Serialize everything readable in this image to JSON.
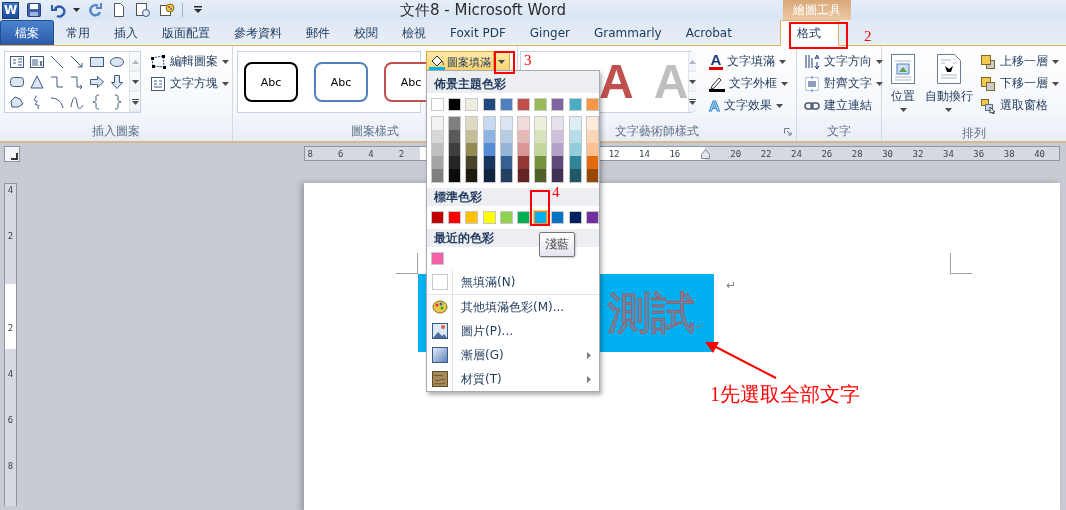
{
  "window": {
    "app_letter": "W",
    "title": "文件8 - Microsoft Word",
    "context_label": "繪圖工具"
  },
  "tabs": [
    {
      "label": "檔案",
      "kind": "file",
      "selected": false
    },
    {
      "label": "常用",
      "kind": "tab",
      "selected": false
    },
    {
      "label": "插入",
      "kind": "tab",
      "selected": false
    },
    {
      "label": "版面配置",
      "kind": "tab",
      "selected": false
    },
    {
      "label": "參考資料",
      "kind": "tab",
      "selected": false
    },
    {
      "label": "郵件",
      "kind": "tab",
      "selected": false
    },
    {
      "label": "校閱",
      "kind": "tab",
      "selected": false
    },
    {
      "label": "檢視",
      "kind": "tab",
      "selected": false
    },
    {
      "label": "Foxit PDF",
      "kind": "tab",
      "selected": false
    },
    {
      "label": "Ginger",
      "kind": "tab",
      "selected": false
    },
    {
      "label": "Grammarly",
      "kind": "tab",
      "selected": false
    },
    {
      "label": "Acrobat",
      "kind": "tab",
      "selected": false
    },
    {
      "label": "格式",
      "kind": "context",
      "selected": true
    }
  ],
  "ribbon": {
    "insert_shapes": {
      "label": "插入圖案",
      "buttons": [
        {
          "label": "編輯圖案",
          "kind": "edit_shape",
          "menu": true
        },
        {
          "label": "文字方塊",
          "kind": "text_box",
          "menu": true
        }
      ]
    },
    "shape_styles": {
      "label": "圖案樣式",
      "samples": [
        {
          "text": "Abc",
          "color": "#000000"
        },
        {
          "text": "Abc",
          "color": "#4f81bd"
        },
        {
          "text": "Abc",
          "color": "#c0504d"
        }
      ],
      "fill_button": {
        "label": "圖案填滿",
        "expanded": true
      }
    },
    "wordart_styles": {
      "label": "文字藝術師樣式",
      "samples": [
        {
          "text": "A",
          "color": "#c0504d"
        },
        {
          "text": "A",
          "color": "#bfbfbf"
        }
      ],
      "buttons": [
        {
          "label": "文字填滿",
          "kind": "text_fill",
          "icon_text": "A",
          "menu": true
        },
        {
          "label": "文字外框",
          "kind": "text_outline",
          "menu": true
        },
        {
          "label": "文字效果",
          "kind": "text_effects",
          "icon_text": "A",
          "menu": true
        }
      ]
    },
    "text": {
      "label": "文字",
      "buttons": [
        {
          "label": "文字方向",
          "kind": "direction",
          "menu": true
        },
        {
          "label": "對齊文字",
          "kind": "align",
          "menu": true
        },
        {
          "label": "建立連結",
          "kind": "link",
          "menu": false
        }
      ]
    },
    "arrange": {
      "label": "排列",
      "large_buttons": [
        {
          "label": "位置",
          "kind": "position"
        },
        {
          "label": "自動換行",
          "kind": "wrap"
        }
      ],
      "buttons": [
        {
          "label": "上移一層",
          "kind": "forward",
          "menu": true
        },
        {
          "label": "下移一層",
          "kind": "backward",
          "menu": true
        },
        {
          "label": "選取窗格",
          "kind": "pane",
          "menu": false
        }
      ]
    }
  },
  "ruler": {
    "left_labels": [
      "8",
      "6",
      "4",
      "2"
    ],
    "labels_before_marker": [
      "12",
      "14",
      "16"
    ],
    "labels_after_marker": [
      "20",
      "22",
      "24",
      "26",
      "28",
      "30",
      "32",
      "34",
      "36",
      "38",
      "40"
    ]
  },
  "vertical_ruler": {
    "above": [
      "4",
      "2"
    ],
    "below": [
      "2",
      "4",
      "6",
      "8"
    ]
  },
  "document": {
    "selected_text": "測試",
    "text_end_mark": "↵",
    "paragraph_mark": "↵"
  },
  "fill_menu": {
    "theme_header": "佈景主題色彩",
    "theme_columns": [
      {
        "color": "#ffffff",
        "shades": [
          {
            "color": "#f2f2f2"
          },
          {
            "color": "#d8d8d8"
          },
          {
            "color": "#bfbfbf"
          },
          {
            "color": "#a5a5a5"
          },
          {
            "color": "#7f7f7f"
          }
        ]
      },
      {
        "color": "#000000",
        "shades": [
          {
            "color": "#7f7f7f"
          },
          {
            "color": "#595959"
          },
          {
            "color": "#3f3f3f"
          },
          {
            "color": "#262626"
          },
          {
            "color": "#0c0c0c"
          }
        ]
      },
      {
        "color": "#eeece1",
        "shades": [
          {
            "color": "#ddd9c3"
          },
          {
            "color": "#c4bd97"
          },
          {
            "color": "#938953"
          },
          {
            "color": "#494429"
          },
          {
            "color": "#1d1b10"
          }
        ]
      },
      {
        "color": "#1f497d",
        "shades": [
          {
            "color": "#c6d9f0"
          },
          {
            "color": "#8db3e2"
          },
          {
            "color": "#548dd4"
          },
          {
            "color": "#17365d"
          },
          {
            "color": "#0f243e"
          }
        ]
      },
      {
        "color": "#4f81bd",
        "shades": [
          {
            "color": "#dbe5f1"
          },
          {
            "color": "#b8cce4"
          },
          {
            "color": "#95b3d7"
          },
          {
            "color": "#366092"
          },
          {
            "color": "#244061"
          }
        ]
      },
      {
        "color": "#c0504d",
        "shades": [
          {
            "color": "#f2dcdb"
          },
          {
            "color": "#e5b9b7"
          },
          {
            "color": "#d99694"
          },
          {
            "color": "#953734"
          },
          {
            "color": "#632423"
          }
        ]
      },
      {
        "color": "#9bbb59",
        "shades": [
          {
            "color": "#ebf1dd"
          },
          {
            "color": "#d7e3bc"
          },
          {
            "color": "#c3d69b"
          },
          {
            "color": "#76923c"
          },
          {
            "color": "#4f6128"
          }
        ]
      },
      {
        "color": "#8064a2",
        "shades": [
          {
            "color": "#e5e0ec"
          },
          {
            "color": "#ccc1d9"
          },
          {
            "color": "#b2a2c7"
          },
          {
            "color": "#5f497a"
          },
          {
            "color": "#3f3151"
          }
        ]
      },
      {
        "color": "#4bacc6",
        "shades": [
          {
            "color": "#dbeef3"
          },
          {
            "color": "#b7dde8"
          },
          {
            "color": "#92cddc"
          },
          {
            "color": "#31859b"
          },
          {
            "color": "#205867"
          }
        ]
      },
      {
        "color": "#f79646",
        "shades": [
          {
            "color": "#fdeada"
          },
          {
            "color": "#fbd5b5"
          },
          {
            "color": "#fac08f"
          },
          {
            "color": "#e36c09"
          },
          {
            "color": "#974806"
          }
        ]
      }
    ],
    "standard_header": "標準色彩",
    "standard_colors": [
      {
        "color": "#c00000",
        "selected": false
      },
      {
        "color": "#ff0000",
        "selected": false
      },
      {
        "color": "#ffc000",
        "selected": false
      },
      {
        "color": "#ffff00",
        "selected": false
      },
      {
        "color": "#92d050",
        "selected": false
      },
      {
        "color": "#00b050",
        "selected": false
      },
      {
        "color": "#00b0f0",
        "selected": true
      },
      {
        "color": "#0070c0",
        "selected": false
      },
      {
        "color": "#002060",
        "selected": false
      },
      {
        "color": "#7030a0",
        "selected": false
      }
    ],
    "hover_tooltip": "淺藍",
    "recent_header": "最近的色彩",
    "recent_colors": [
      {
        "color": "#f462a8"
      }
    ],
    "items": [
      {
        "label": "無填滿(N)",
        "kind": "no_fill",
        "submenu": false
      },
      {
        "label": "其他填滿色彩(M)...",
        "kind": "more_colors",
        "submenu": false
      },
      {
        "label": "圖片(P)...",
        "kind": "picture",
        "submenu": false
      },
      {
        "label": "漸層(G)",
        "kind": "gradient",
        "submenu": true
      },
      {
        "label": "材質(T)",
        "kind": "texture",
        "submenu": true
      }
    ]
  },
  "annotations": {
    "tab_marker": "2",
    "dropdown_marker": "3",
    "swatch_marker": "4",
    "instruction": "1先選取全部文字"
  }
}
